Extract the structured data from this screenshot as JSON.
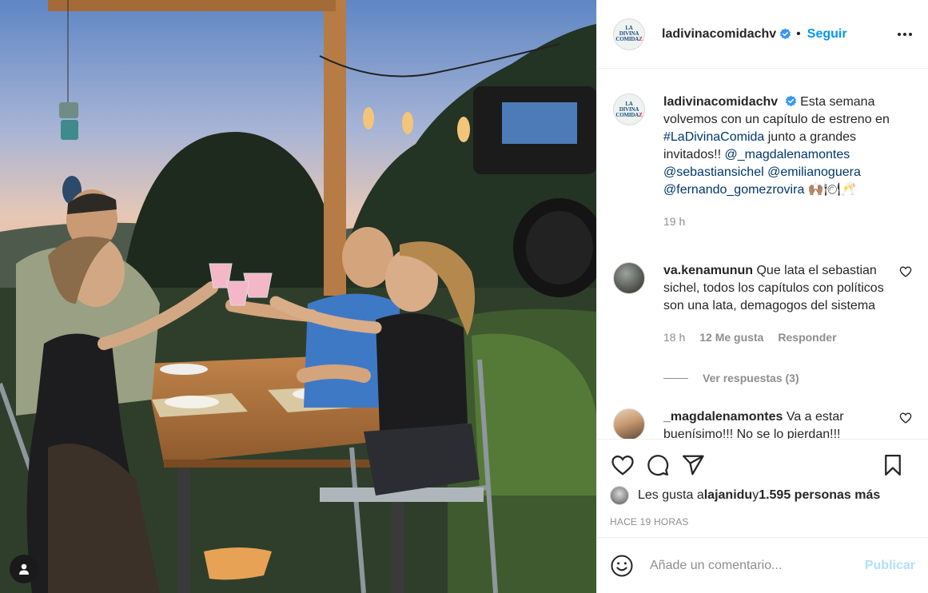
{
  "post": {
    "username": "ladivinacomidachv",
    "logo_lines": [
      "LA",
      "DIVINA",
      "COMIDA",
      "Z"
    ],
    "follow_label": "Seguir",
    "separator": "•"
  },
  "caption": {
    "username": "ladivinacomidachv",
    "text_1": "Esta semana volvemos con un capítulo de estreno en ",
    "hashtag": "#LaDivinaComida",
    "text_2": " junto a grandes invitados!! ",
    "mention_1": "@_magdalenamontes",
    "mention_2": "@sebastiansichel",
    "mention_3": "@emilianoguera",
    "mention_4": "@fernando_gomezrovira",
    "emojis": "🙌🏽🍽🥂",
    "age": "19 h"
  },
  "comments": [
    {
      "username": "va.kenamunun",
      "text": "Que lata el sebastian sichel, todos los capítulos con políticos son una lata, demagogos del sistema",
      "age": "18 h",
      "likes": "12 Me gusta",
      "reply_label": "Responder",
      "view_replies": "Ver respuestas (3)"
    },
    {
      "username": "_magdalenamontes",
      "text": "Va a estar buenísimo!!! No se lo pierdan!!!"
    }
  ],
  "likes": {
    "prefix": "Les gusta a ",
    "user": "lajanidu",
    "middle": " y ",
    "count": "1.595 personas más"
  },
  "timestamp": "HACE 19 HORAS",
  "comment_box": {
    "placeholder": "Añade un comentario...",
    "publish_label": "Publicar"
  },
  "colors": {
    "link": "#00376b",
    "follow": "#0095f6",
    "publish_disabled": "#b2dffc",
    "verified": "#3897f0"
  }
}
